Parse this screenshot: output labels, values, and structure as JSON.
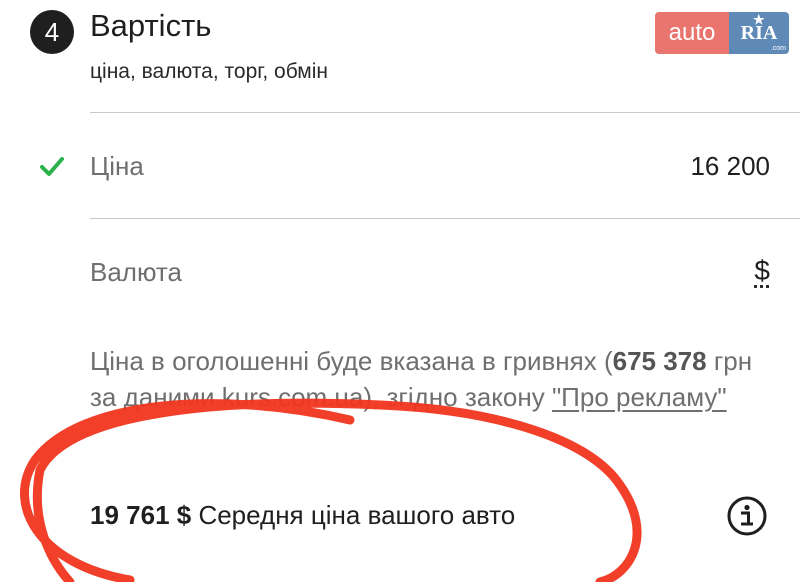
{
  "section": {
    "step_number": "4",
    "title": "Вартість",
    "subtitle": "ціна, валюта, торг, обмін"
  },
  "logo": {
    "left_text": "auto",
    "right_text": "RIA",
    "domain_suffix": ".com"
  },
  "price_row": {
    "label": "Ціна",
    "value": "16 200",
    "status": "completed"
  },
  "currency_row": {
    "label": "Валюта",
    "value": "$"
  },
  "notice": {
    "text_before": "Ціна в оголошенні буде вказана в гривнях (",
    "uah_amount": "675 378",
    "text_middle": " грн за даними kurs.com.ua), згідно закону ",
    "law_link": "\"Про рекламу\""
  },
  "average_price": {
    "amount": "19 761 $",
    "label": " Середня ціна вашого авто"
  },
  "colors": {
    "accent_check": "#2bb24c",
    "annotation_red": "#f0351e",
    "logo_auto": "#e9756e",
    "logo_ria": "#5f8ab8"
  },
  "icons": {
    "check": "check-icon",
    "info": "info-icon",
    "star": "star-icon"
  }
}
